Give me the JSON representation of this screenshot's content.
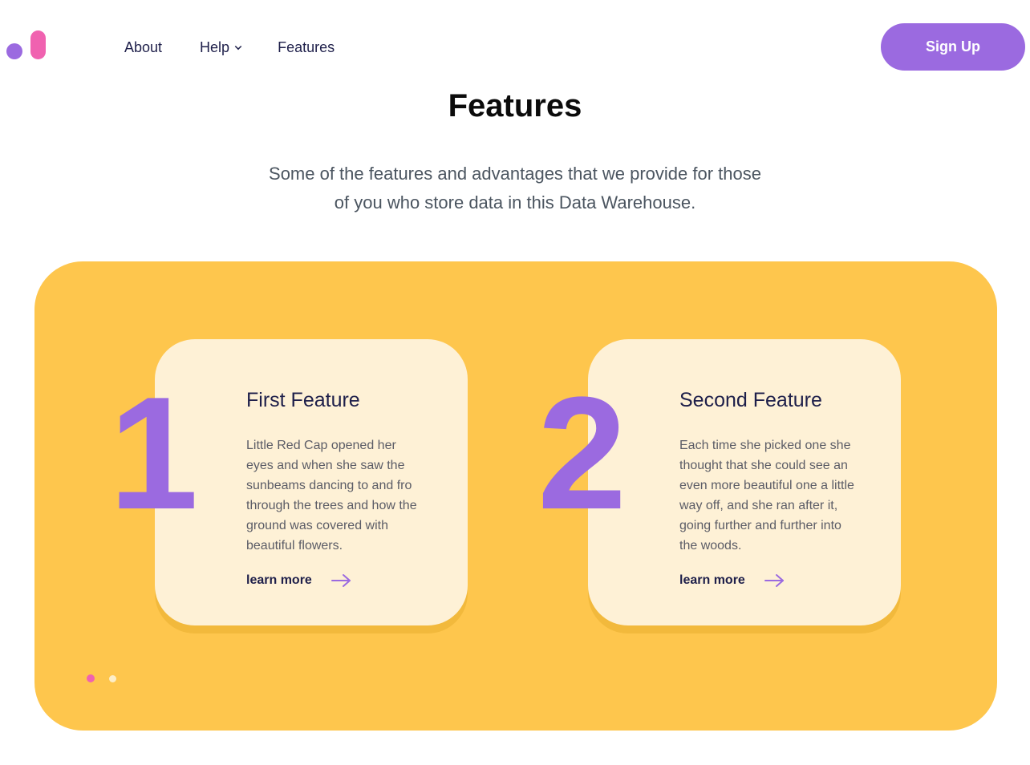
{
  "header": {
    "logo_icon": "logo-mark-icon",
    "nav": [
      {
        "label": "About"
      },
      {
        "label": "Help"
      },
      {
        "label": "Features"
      }
    ],
    "signup_label": "Sign Up"
  },
  "section": {
    "title": "Features",
    "subtitle_line1": "Some of the features and advantages that we provide for those",
    "subtitle_line2": "of you who store data in this Data Warehouse."
  },
  "features": [
    {
      "number": "1",
      "title": "First Feature",
      "text": "Little Red Cap opened her eyes and when she saw the sunbeams dancing to and fro through the trees and how the ground was covered with beautiful flowers.",
      "link": "learn more"
    },
    {
      "number": "2",
      "title": "Second Feature",
      "text": "Each time she picked one she thought that she could see an even more beautiful one a little way off, and she ran after it, going further and further into the woods.",
      "link": "learn more"
    }
  ],
  "pagination": {
    "total": 2,
    "active": 1
  },
  "colors": {
    "accent_purple": "#9b6ae0",
    "accent_pink": "#f062b0",
    "panel_yellow": "#fec64d",
    "card_cream": "#fef1d6",
    "text_dark": "#1e1f4a"
  }
}
